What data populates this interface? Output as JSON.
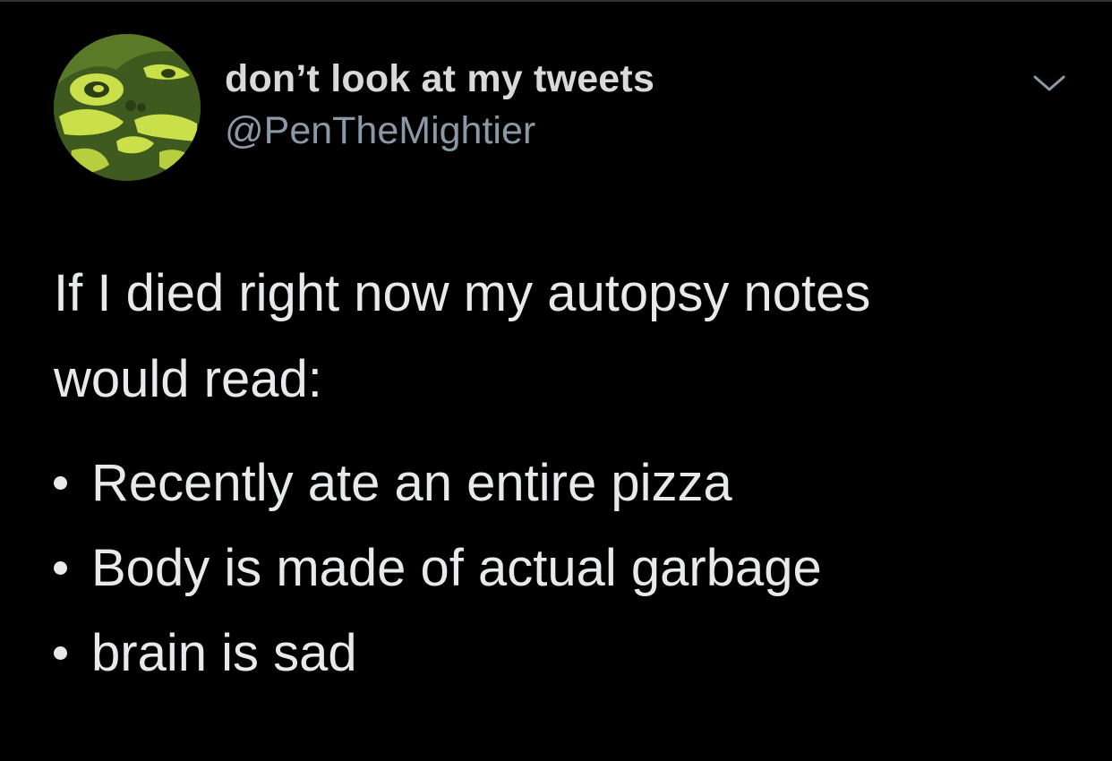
{
  "tweet": {
    "author": {
      "display_name": "don’t look at my tweets",
      "handle": "@PenTheMightier",
      "avatar_icon": "avatar-face-icon"
    },
    "menu_icon": "chevron-down-icon",
    "body_lines": [
      "If I died right now my autopsy notes",
      "would read:"
    ],
    "bullets": [
      "Recently ate an entire pizza",
      "Body is made of actual garbage",
      "brain is sad"
    ]
  },
  "colors": {
    "background": "#000000",
    "primary_text": "#e7e9ea",
    "secondary_text": "#8b98a5",
    "avatar_dark": "#3f5a1e",
    "avatar_light": "#c9e04a"
  }
}
